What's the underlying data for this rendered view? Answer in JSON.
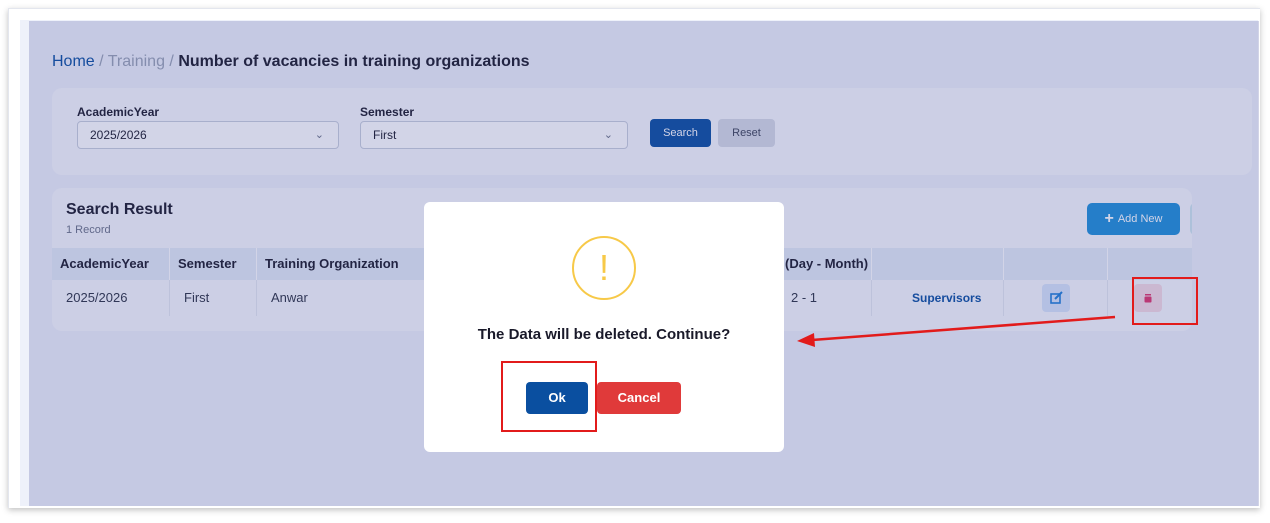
{
  "breadcrumb": {
    "home": "Home",
    "separator": "/",
    "section": "Training",
    "current": "Number of vacancies in training organizations"
  },
  "filters": {
    "academic_year_label": "AcademicYear",
    "academic_year_value": "2025/2026",
    "semester_label": "Semester",
    "semester_value": "First",
    "search_label": "Search",
    "reset_label": "Reset"
  },
  "results": {
    "title": "Search Result",
    "count": "1 Record",
    "add_label": "Add New",
    "columns": [
      "AcademicYear",
      "Semester",
      "Training Organization",
      "(Day - Month)"
    ],
    "rows": [
      {
        "academic_year": "2025/2026",
        "semester": "First",
        "organization": "Anwar",
        "date": "2 - 1",
        "supervisors": "Supervisors"
      }
    ]
  },
  "dialog": {
    "icon": "warning-icon",
    "icon_glyph": "!",
    "message": "The Data will be deleted. Continue?",
    "ok_label": "Ok",
    "cancel_label": "Cancel"
  },
  "colors": {
    "primary": "#0a4fa0",
    "accent": "#1e8fd8",
    "danger": "#e03a3a",
    "warning": "#f7c948",
    "annotation": "#e21b1b"
  }
}
